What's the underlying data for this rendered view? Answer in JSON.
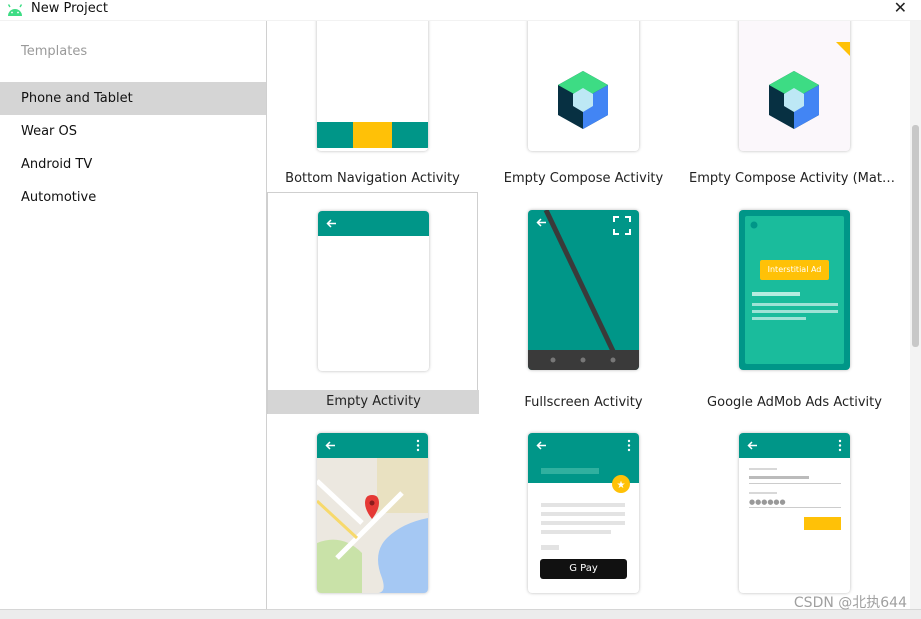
{
  "window": {
    "title": "New Project",
    "close_glyph": "✕"
  },
  "sidebar": {
    "header": "Templates",
    "items": [
      {
        "label": "Phone and Tablet",
        "selected": true
      },
      {
        "label": "Wear OS",
        "selected": false
      },
      {
        "label": "Android TV",
        "selected": false
      },
      {
        "label": "Automotive",
        "selected": false
      }
    ]
  },
  "templates": [
    {
      "label": "Bottom Navigation Activity"
    },
    {
      "label": "Empty Compose Activity"
    },
    {
      "label": "Empty Compose Activity (Material..."
    },
    {
      "label": "Empty Activity",
      "selected": true
    },
    {
      "label": "Fullscreen Activity"
    },
    {
      "label": "Google AdMob Ads Activity",
      "ad_text": "Interstitial Ad"
    },
    {
      "label": ""
    },
    {
      "label": "",
      "pay_text": "G Pay"
    },
    {
      "label": ""
    }
  ],
  "watermark": "CSDN @北执644",
  "colors": {
    "teal": "#009688",
    "teal_dark": "#00796b",
    "amber": "#ffc107",
    "selected_bg": "#d5d5d5"
  }
}
